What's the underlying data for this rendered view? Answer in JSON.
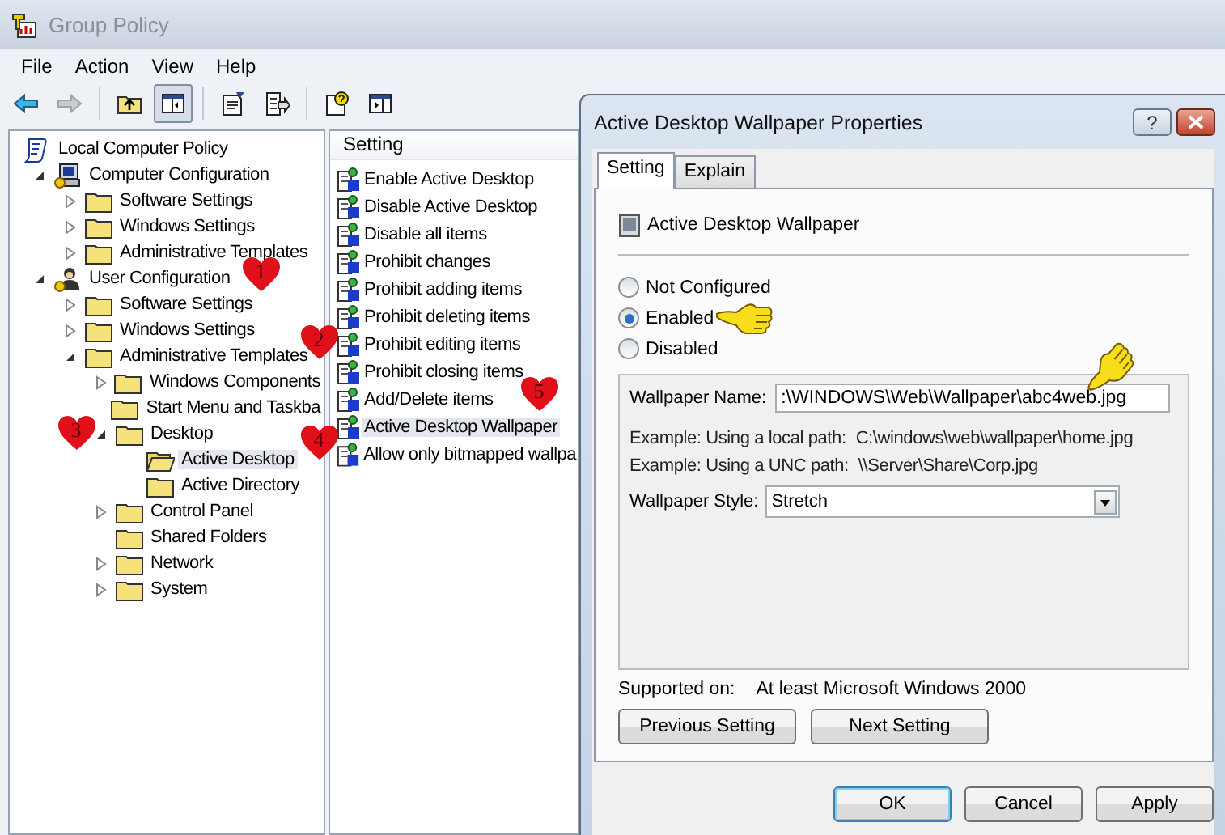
{
  "window": {
    "title": "Group Policy"
  },
  "menu": [
    "File",
    "Action",
    "View",
    "Help"
  ],
  "toolbar": [
    {
      "kind": "back",
      "pressed": false
    },
    {
      "kind": "forward",
      "disabled": true,
      "pressed": false
    },
    {
      "kind": "up",
      "pressed": false
    },
    {
      "kind": "tree",
      "pressed": true
    },
    {
      "kind": "properties",
      "pressed": false
    },
    {
      "kind": "export",
      "pressed": false
    },
    {
      "kind": "help",
      "pressed": false
    },
    {
      "kind": "panel",
      "pressed": false
    }
  ],
  "tree": [
    {
      "label": "Local Computer Policy",
      "kind": "policy",
      "selected": false,
      "children": [
        {
          "label": "Computer Configuration",
          "kind": "computer",
          "expanded": true,
          "selected": false,
          "children": [
            {
              "label": "Software Settings",
              "kind": "folder",
              "expanded": false,
              "selected": false
            },
            {
              "label": "Windows Settings",
              "kind": "folder",
              "expanded": false,
              "selected": false
            },
            {
              "label": "Administrative Templates",
              "kind": "folder",
              "expanded": false,
              "selected": false
            }
          ]
        },
        {
          "label": "User Configuration",
          "kind": "user",
          "expanded": true,
          "selected": false,
          "children": [
            {
              "label": "Software Settings",
              "kind": "folder",
              "expanded": false,
              "selected": false
            },
            {
              "label": "Windows Settings",
              "kind": "folder",
              "expanded": false,
              "selected": false
            },
            {
              "label": "Administrative Templates",
              "kind": "folder",
              "expanded": true,
              "selected": false,
              "children": [
                {
                  "label": "Windows Components",
                  "kind": "folder",
                  "expanded": false,
                  "selected": false
                },
                {
                  "label": "Start Menu and Taskba",
                  "kind": "folder",
                  "selected": false
                },
                {
                  "label": "Desktop",
                  "kind": "folder",
                  "expanded": true,
                  "selected": false,
                  "children": [
                    {
                      "label": "Active Desktop",
                      "kind": "folder",
                      "selected": true
                    },
                    {
                      "label": "Active Directory",
                      "kind": "folder",
                      "selected": false
                    }
                  ]
                },
                {
                  "label": "Control Panel",
                  "kind": "folder",
                  "expanded": false,
                  "selected": false
                },
                {
                  "label": "Shared Folders",
                  "kind": "folder",
                  "selected": false
                },
                {
                  "label": "Network",
                  "kind": "folder",
                  "expanded": false,
                  "selected": false
                },
                {
                  "label": "System",
                  "kind": "folder",
                  "expanded": false,
                  "selected": false
                }
              ]
            }
          ]
        }
      ]
    }
  ],
  "list": {
    "header": "Setting",
    "items": [
      {
        "label": "Enable Active Desktop",
        "selected": false
      },
      {
        "label": "Disable Active Desktop",
        "selected": false
      },
      {
        "label": "Disable all items",
        "selected": false
      },
      {
        "label": "Prohibit changes",
        "selected": false
      },
      {
        "label": "Prohibit adding items",
        "selected": false
      },
      {
        "label": "Prohibit deleting items",
        "selected": false
      },
      {
        "label": "Prohibit editing items",
        "selected": false
      },
      {
        "label": "Prohibit closing items",
        "selected": false
      },
      {
        "label": "Add/Delete items",
        "selected": false
      },
      {
        "label": "Active Desktop Wallpaper",
        "selected": true
      },
      {
        "label": "Allow only bitmapped wallpa",
        "selected": false
      }
    ]
  },
  "dialog": {
    "title": "Active Desktop Wallpaper Properties",
    "help_button": "?",
    "tabs": [
      {
        "label": "Setting",
        "selected": true
      },
      {
        "label": "Explain",
        "selected": false
      }
    ],
    "setting_name": "Active Desktop Wallpaper",
    "options": [
      {
        "label": "Not Configured",
        "selected": false
      },
      {
        "label": "Enabled",
        "selected": true
      },
      {
        "label": "Disabled",
        "selected": false
      }
    ],
    "wallpaper_name": {
      "label": "Wallpaper Name:",
      "value": ":\\WINDOWS\\Web\\Wallpaper\\abc4web.jpg"
    },
    "examples": [
      {
        "label": "Example: Using a local path:",
        "value": "C:\\windows\\web\\wallpaper\\home.jpg"
      },
      {
        "label": "Example: Using a UNC path:",
        "value": "\\\\Server\\Share\\Corp.jpg"
      }
    ],
    "wallpaper_style": {
      "label": "Wallpaper Style:",
      "value": "Stretch"
    },
    "supported_on": {
      "label": "Supported on:",
      "value": "At least Microsoft Windows 2000"
    },
    "nav_buttons": [
      "Previous Setting",
      "Next Setting"
    ],
    "buttons": [
      {
        "label": "OK",
        "default": true
      },
      {
        "label": "Cancel",
        "default": false
      },
      {
        "label": "Apply",
        "default": false
      }
    ]
  },
  "annotations": [
    {
      "label": "1"
    },
    {
      "label": "2"
    },
    {
      "label": "3"
    },
    {
      "label": "4"
    },
    {
      "label": "5"
    }
  ]
}
